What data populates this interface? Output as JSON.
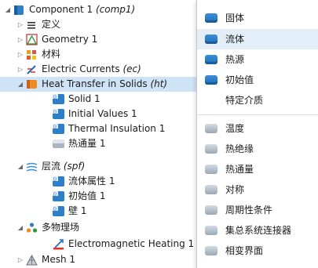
{
  "tree": {
    "component": {
      "name": "Component 1",
      "tag": "(comp1)"
    },
    "definitions": "定义",
    "geometry": "Geometry 1",
    "materials": "材料",
    "electric_currents": {
      "name": "Electric Currents",
      "tag": "(ec)"
    },
    "heat_transfer": {
      "name": "Heat Transfer in Solids",
      "tag": "(ht)"
    },
    "solid": "Solid 1",
    "initial_values": "Initial Values 1",
    "thermal_insulation": "Thermal Insulation 1",
    "heat_flux": "热通量 1",
    "laminar_flow": {
      "name": "层流",
      "tag": "(spf)"
    },
    "fluid_properties": "流体属性 1",
    "initial_values_cn": "初始值 1",
    "wall": "壁 1",
    "multiphysics": "多物理场",
    "em_heating": "Electromagnetic Heating 1",
    "mesh": "Mesh 1"
  },
  "menu": {
    "items": [
      "固体",
      "流体",
      "热源",
      "初始值",
      "特定介质",
      "温度",
      "热绝缘",
      "热通量",
      "对称",
      "周期性条件",
      "集总系统连接器",
      "相变界面"
    ],
    "highlighted_index": 1
  },
  "colors": {
    "selection": "#cfe3f7",
    "menu_highlight": "#e3eef9",
    "accent_blue": "#1f6fb8"
  }
}
